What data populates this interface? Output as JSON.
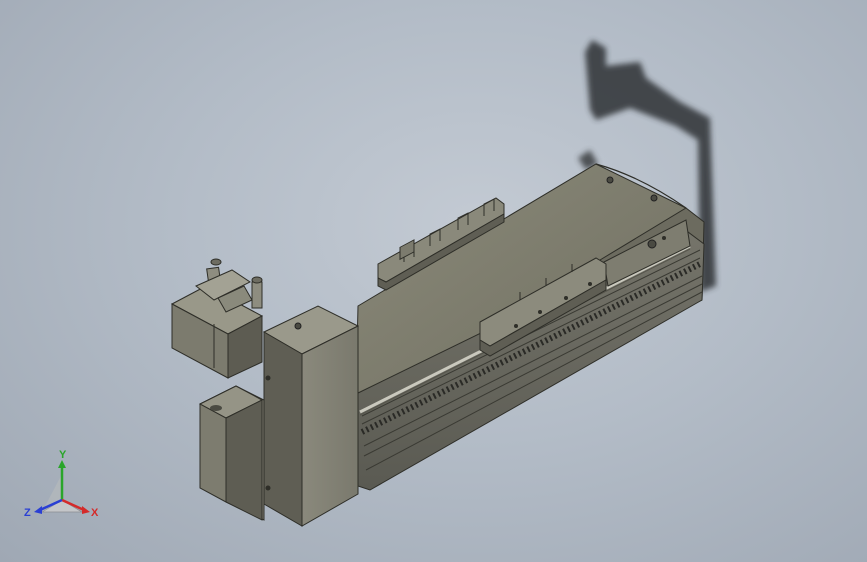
{
  "viewport": {
    "background": "#b3bcc7",
    "model": "linear-actuator-module"
  },
  "triad": {
    "x_label": "X",
    "y_label": "Y",
    "z_label": "Z",
    "x_color": "#d42a2a",
    "y_color": "#2aa52a",
    "z_color": "#2a3fd4"
  }
}
